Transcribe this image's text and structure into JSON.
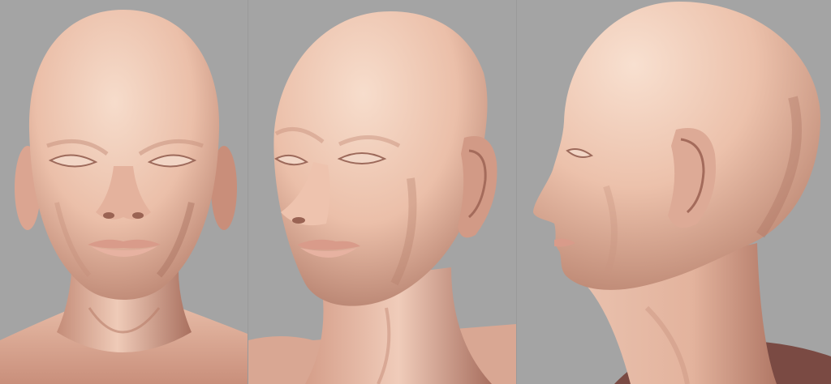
{
  "image": {
    "subject": "",
    "panels": [
      {
        "id": "front",
        "label": ""
      },
      {
        "id": "three-quarter",
        "label": ""
      },
      {
        "id": "profile",
        "label": ""
      }
    ]
  },
  "colors": {
    "background": "#a4a4a4",
    "skin_light": "#f3d2c0",
    "skin_mid": "#e6b6a0",
    "skin_shadow": "#b67f6d",
    "skin_deep": "#8e5c50",
    "lips": "#d89c8c",
    "garment": "#7a4a43"
  }
}
